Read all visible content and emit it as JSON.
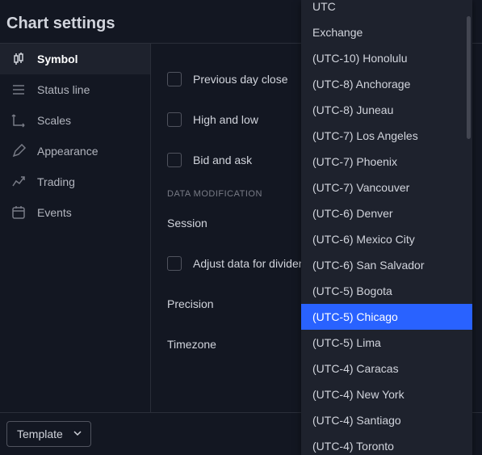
{
  "header": {
    "title": "Chart settings"
  },
  "sidebar": {
    "items": [
      {
        "label": "Symbol"
      },
      {
        "label": "Status line"
      },
      {
        "label": "Scales"
      },
      {
        "label": "Appearance"
      },
      {
        "label": "Trading"
      },
      {
        "label": "Events"
      }
    ]
  },
  "content": {
    "checkboxes": [
      {
        "label": "Previous day close"
      },
      {
        "label": "High and low"
      },
      {
        "label": "Bid and ask"
      }
    ],
    "section_title": "DATA MODIFICATION",
    "rows": [
      {
        "label": "Session"
      },
      {
        "label": "Adjust data for dividends"
      },
      {
        "label": "Precision"
      },
      {
        "label": "Timezone"
      }
    ]
  },
  "footer": {
    "template_label": "Template"
  },
  "dropdown": {
    "selected_index": 12,
    "items": [
      "UTC",
      "Exchange",
      "(UTC-10) Honolulu",
      "(UTC-8) Anchorage",
      "(UTC-8) Juneau",
      "(UTC-7) Los Angeles",
      "(UTC-7) Phoenix",
      "(UTC-7) Vancouver",
      "(UTC-6) Denver",
      "(UTC-6) Mexico City",
      "(UTC-6) San Salvador",
      "(UTC-5) Bogota",
      "(UTC-5) Chicago",
      "(UTC-5) Lima",
      "(UTC-4) Caracas",
      "(UTC-4) New York",
      "(UTC-4) Santiago",
      "(UTC-4) Toronto"
    ]
  }
}
